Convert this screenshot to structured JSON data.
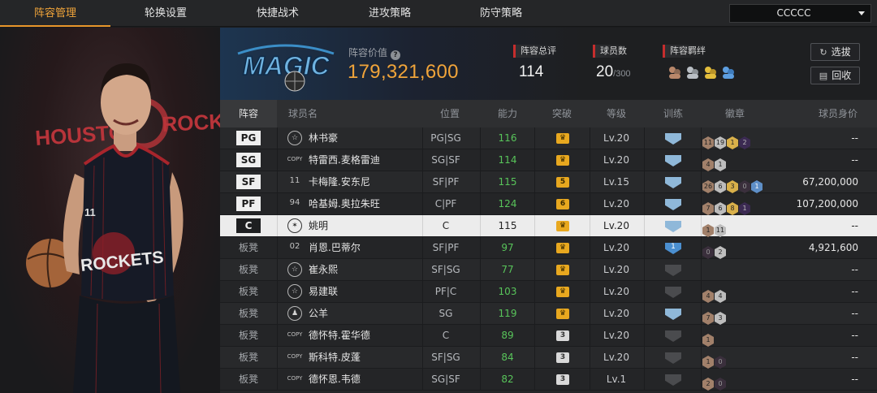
{
  "tabs": [
    "阵容管理",
    "轮换设置",
    "快捷战术",
    "进攻策略",
    "防守策略"
  ],
  "team_select": "CCCCC",
  "team": {
    "value_label": "阵容价值",
    "value": "179,321,600",
    "rating_label": "阵容总评",
    "rating": "114",
    "players_label": "球员数",
    "players": "20",
    "players_max": "/300",
    "bond_label": "阵容羁绊"
  },
  "buttons": {
    "draft": "选拔",
    "recycle": "回收"
  },
  "columns": [
    "阵容",
    "球员名",
    "位置",
    "能力",
    "突破",
    "等级",
    "训练",
    "徽章",
    "球员身价"
  ],
  "rows": [
    {
      "slot": "PG",
      "icon": "☆",
      "name": "林书豪",
      "position": "PG|SG",
      "ability": "116",
      "brk": "♛",
      "level": "Lv.20",
      "badges": [
        "11",
        "19",
        "1",
        "2"
      ],
      "worth": "--"
    },
    {
      "slot": "SG",
      "icon": "COPY",
      "name": "特雷西.麦格雷迪",
      "position": "SG|SF",
      "ability": "114",
      "brk": "♛",
      "level": "Lv.20",
      "badges": [
        "4",
        "1"
      ],
      "worth": "--"
    },
    {
      "slot": "SF",
      "icon": "11",
      "name": "卡梅隆.安东尼",
      "position": "SF|PF",
      "ability": "115",
      "brk": "5",
      "level": "Lv.15",
      "badges": [
        "26",
        "6",
        "3",
        "0",
        "1"
      ],
      "worth": "67,200,000"
    },
    {
      "slot": "PF",
      "icon": "94",
      "name": "哈基姆.奥拉朱旺",
      "position": "C|PF",
      "ability": "124",
      "brk": "6",
      "level": "Lv.20",
      "badges": [
        "7",
        "6",
        "8",
        "1"
      ],
      "worth": "107,200,000"
    },
    {
      "slot": "C",
      "icon": "✶",
      "name": "姚明",
      "position": "C",
      "ability": "115",
      "brk": "♛",
      "level": "Lv.20",
      "badges": [
        "1",
        "11"
      ],
      "worth": "--"
    },
    {
      "slot": "板凳",
      "icon": "02",
      "name": "肖恩.巴蒂尔",
      "position": "SF|PF",
      "ability": "97",
      "brk": "♛",
      "level": "Lv.20",
      "train": "1",
      "badges": [
        "0",
        "2"
      ],
      "worth": "4,921,600"
    },
    {
      "slot": "板凳",
      "icon": "☆",
      "name": "崔永熙",
      "position": "SF|SG",
      "ability": "77",
      "brk": "♛",
      "level": "Lv.20",
      "badges": [],
      "worth": "--"
    },
    {
      "slot": "板凳",
      "icon": "☆",
      "name": "易建联",
      "position": "PF|C",
      "ability": "103",
      "brk": "♛",
      "level": "Lv.20",
      "badges": [
        "4",
        "4"
      ],
      "worth": "--"
    },
    {
      "slot": "板凳",
      "icon": "♟",
      "name": "公羊",
      "position": "SG",
      "ability": "119",
      "brk": "♛",
      "level": "Lv.20",
      "badges": [
        "7",
        "3"
      ],
      "worth": "--"
    },
    {
      "slot": "板凳",
      "icon": "COPY",
      "name": "德怀特.霍华德",
      "position": "C",
      "ability": "89",
      "brk": "3",
      "level": "Lv.20",
      "badges": [
        "1"
      ],
      "worth": "--"
    },
    {
      "slot": "板凳",
      "icon": "COPY",
      "name": "斯科特.皮蓬",
      "position": "SF|SG",
      "ability": "84",
      "brk": "3",
      "level": "Lv.20",
      "badges": [
        "1",
        "0"
      ],
      "worth": "--"
    },
    {
      "slot": "板凳",
      "icon": "COPY",
      "name": "德怀恩.韦德",
      "position": "SG|SF",
      "ability": "82",
      "brk": "3",
      "level": "Lv.1",
      "badges": [
        "2",
        "0"
      ],
      "worth": "--"
    }
  ],
  "portrait": {
    "team_text": "HOUSTON ROCKETS",
    "jersey_text": "ROCKETS",
    "jersey_number": "11"
  },
  "logo_text": "MAGIC"
}
